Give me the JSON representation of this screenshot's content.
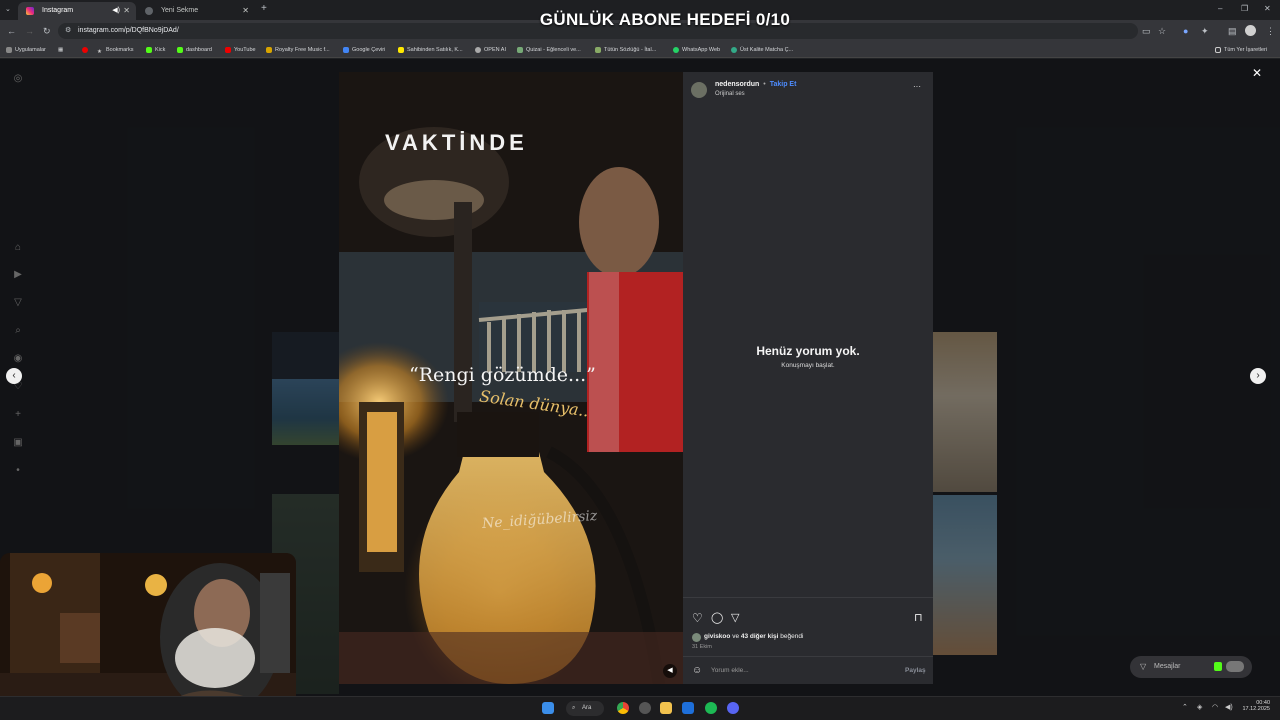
{
  "browser": {
    "tabs": [
      {
        "label": "Instagram",
        "active": true
      },
      {
        "label": "Yeni Sekme",
        "active": false
      }
    ],
    "url": "instagram.com/p/DQfBNo9jDAd/",
    "bookmarks": [
      "Uygulamalar",
      "Bookmarks",
      "Kick",
      "dashboard",
      "YouTube",
      "Royalty Free Music f...",
      "Google Çeviri",
      "Sahibinden Satılık, K...",
      "OPEN AI",
      "Quizai - Eğlenceli ve...",
      "Tütün Sözlüğü - İtal...",
      "WhatsApp Web",
      "Üst Kalite Matcha Ç..."
    ],
    "all_bookmarks": "Tüm Yer İşaretleri"
  },
  "stream_overlay": {
    "title": "GÜNLÜK ABONE HEDEFİ 0/10"
  },
  "post": {
    "media": {
      "heading": "VAKTİNDE",
      "caption_line1": "“Rengi gözümde...”",
      "caption_line2": "Solan dünya..",
      "watermark": "Ne_idiğübelirsiz"
    },
    "author": "nedensordun",
    "separator": "•",
    "follow_label": "Takip Et",
    "audio": "Orijinal ses",
    "more": "···",
    "empty_title": "Henüz yorum yok.",
    "empty_sub": "Konuşmayı başlat.",
    "likes_user": "giviskoo",
    "likes_mid": "ve",
    "likes_count": "43 diğer kişi",
    "likes_suffix": "beğendi",
    "date": "31 Ekim",
    "comment_placeholder": "Yorum ekle...",
    "share_label": "Paylaş"
  },
  "messages_label": "Mesajlar",
  "taskbar": {
    "search": "Ara",
    "time": "00:40",
    "date": "17.12.2025"
  },
  "colors": {
    "accent": "#0095f6",
    "panel": "#2a2b2f",
    "page": "#121316"
  }
}
